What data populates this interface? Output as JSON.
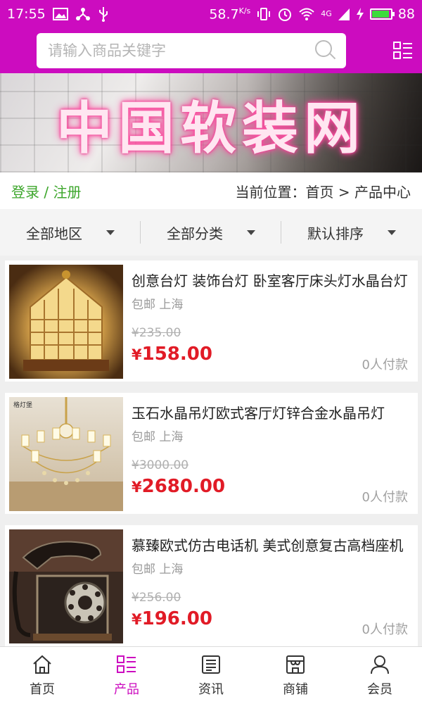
{
  "status_bar": {
    "time": "17:55",
    "speed": "58.7",
    "speed_unit": "K/s",
    "network": "4G",
    "battery": "88"
  },
  "search": {
    "placeholder": "请输入商品关键字"
  },
  "banner": {
    "title": "中国软装网"
  },
  "location": {
    "login": "登录 / 注册",
    "prefix": "当前位置：",
    "home": "首页",
    "separator": " > ",
    "current": "产品中心"
  },
  "filters": [
    {
      "label": "全部地区"
    },
    {
      "label": "全部分类"
    },
    {
      "label": "默认排序"
    }
  ],
  "products": [
    {
      "title": "创意台灯 装饰台灯 卧室客厅床头灯水晶台灯",
      "location": "包邮 上海",
      "old_price": "¥235.00",
      "price_symbol": "¥",
      "price": "158.00",
      "buyers": "0人付款"
    },
    {
      "title": "玉石水晶吊灯欧式客厅灯锌合金水晶吊灯",
      "location": "包邮 上海",
      "old_price": "¥3000.00",
      "price_symbol": "¥",
      "price": "2680.00",
      "buyers": "0人付款",
      "image_brand": "格灯堡"
    },
    {
      "title": "慕臻欧式仿古电话机 美式创意复古高档座机",
      "location": "包邮 上海",
      "old_price": "¥256.00",
      "price_symbol": "¥",
      "price": "196.00",
      "buyers": "0人付款"
    }
  ],
  "nav": [
    {
      "label": "首页",
      "icon": "home-icon"
    },
    {
      "label": "产品",
      "icon": "product-list-icon",
      "active": true
    },
    {
      "label": "资讯",
      "icon": "news-icon"
    },
    {
      "label": "商铺",
      "icon": "shop-icon"
    },
    {
      "label": "会员",
      "icon": "member-icon"
    }
  ],
  "colors": {
    "brand": "#cc0cbf",
    "price": "#e11b26",
    "login": "#3ca62b"
  }
}
